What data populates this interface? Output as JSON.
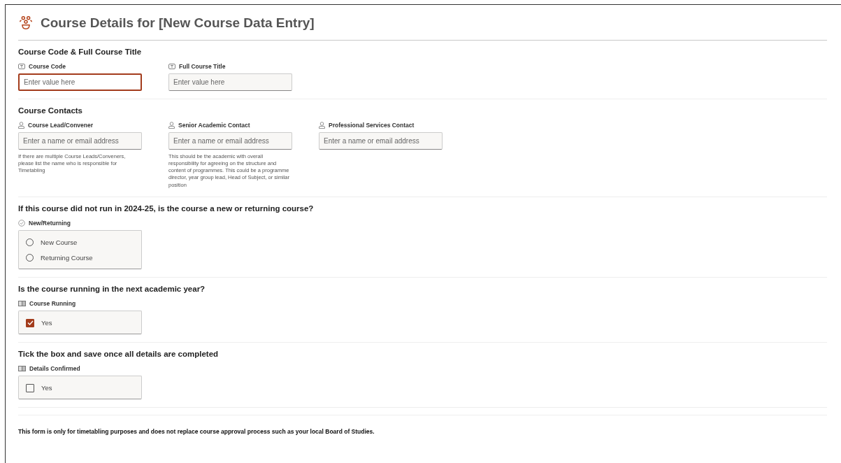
{
  "header": {
    "title": "Course Details for [New Course Data Entry]"
  },
  "sections": [
    {
      "heading": "Course Code & Full Course Title",
      "fields": [
        {
          "kind": "text",
          "label": "Course Code",
          "placeholder": "Enter value here",
          "focused": true
        },
        {
          "kind": "text",
          "label": "Full Course Title",
          "placeholder": "Enter value here",
          "focused": false
        }
      ]
    },
    {
      "heading": "Course Contacts",
      "fields": [
        {
          "kind": "person",
          "label": "Course Lead/Convener",
          "placeholder": "Enter a name or email address",
          "focused": false,
          "hint": "If there are multiple Course Leads/Conveners, please list the name who is responsible for Timetabling"
        },
        {
          "kind": "person",
          "label": "Senior Academic Contact",
          "placeholder": "Enter a name or email address",
          "focused": false,
          "hint": "This should be the academic with overall responsibility for agreeing on the structure and content of programmes. This could be a programme director, year group lead, Head of Subject, or similar position"
        },
        {
          "kind": "person",
          "label": "Professional Services Contact",
          "placeholder": "Enter a name or email address",
          "focused": false
        }
      ]
    },
    {
      "heading": "If this course did not run in 2024-25, is the course a new or returning course?",
      "fields": [
        {
          "kind": "radio",
          "label": "New/Returning",
          "options": [
            {
              "label": "New Course",
              "selected": false
            },
            {
              "label": "Returning Course",
              "selected": false
            }
          ]
        }
      ]
    },
    {
      "heading": "Is the course running in the next academic year?",
      "fields": [
        {
          "kind": "checkbox",
          "label": "Course Running",
          "options": [
            {
              "label": "Yes",
              "checked": true
            }
          ]
        }
      ]
    },
    {
      "heading": "Tick the box and save once all details are completed",
      "fields": [
        {
          "kind": "checkbox",
          "label": "Details Confirmed",
          "options": [
            {
              "label": "Yes",
              "checked": false
            }
          ]
        }
      ]
    }
  ],
  "footer": "This form is only for timetabling purposes and does not replace course approval process such as your local Board of Studies."
}
